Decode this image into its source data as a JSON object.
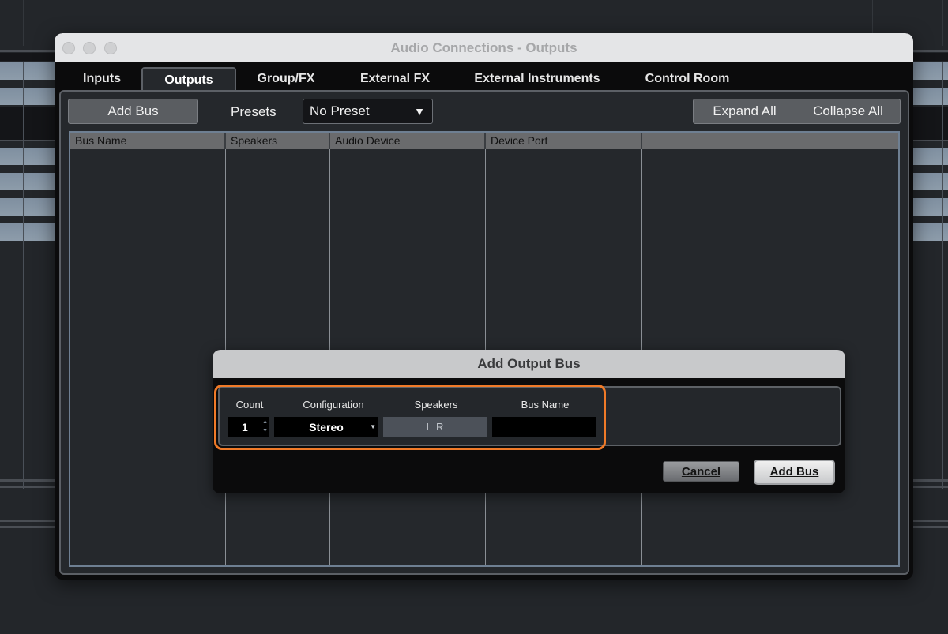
{
  "window": {
    "title": "Audio Connections - Outputs",
    "tabs": [
      {
        "label": "Inputs",
        "active": false
      },
      {
        "label": "Outputs",
        "active": true
      },
      {
        "label": "Group/FX",
        "active": false
      },
      {
        "label": "External FX",
        "active": false
      },
      {
        "label": "External Instruments",
        "active": false
      },
      {
        "label": "Control Room",
        "active": false
      }
    ]
  },
  "toolbar": {
    "add_bus_label": "Add Bus",
    "presets_label": "Presets",
    "preset_value": "No Preset",
    "expand_all_label": "Expand All",
    "collapse_all_label": "Collapse All",
    "dropdown_icon": "triangle-down-icon"
  },
  "table": {
    "columns": [
      "Bus Name",
      "Speakers",
      "Audio Device",
      "Device Port",
      ""
    ],
    "rows": []
  },
  "dialog": {
    "title": "Add Output Bus",
    "fields": {
      "count_label": "Count",
      "count_value": "1",
      "configuration_label": "Configuration",
      "configuration_value": "Stereo",
      "speakers_label": "Speakers",
      "speakers_value": "L R",
      "bus_name_label": "Bus Name",
      "bus_name_value": ""
    },
    "cancel_label": "Cancel",
    "add_bus_label": "Add Bus",
    "highlight_color": "#f07a28"
  }
}
